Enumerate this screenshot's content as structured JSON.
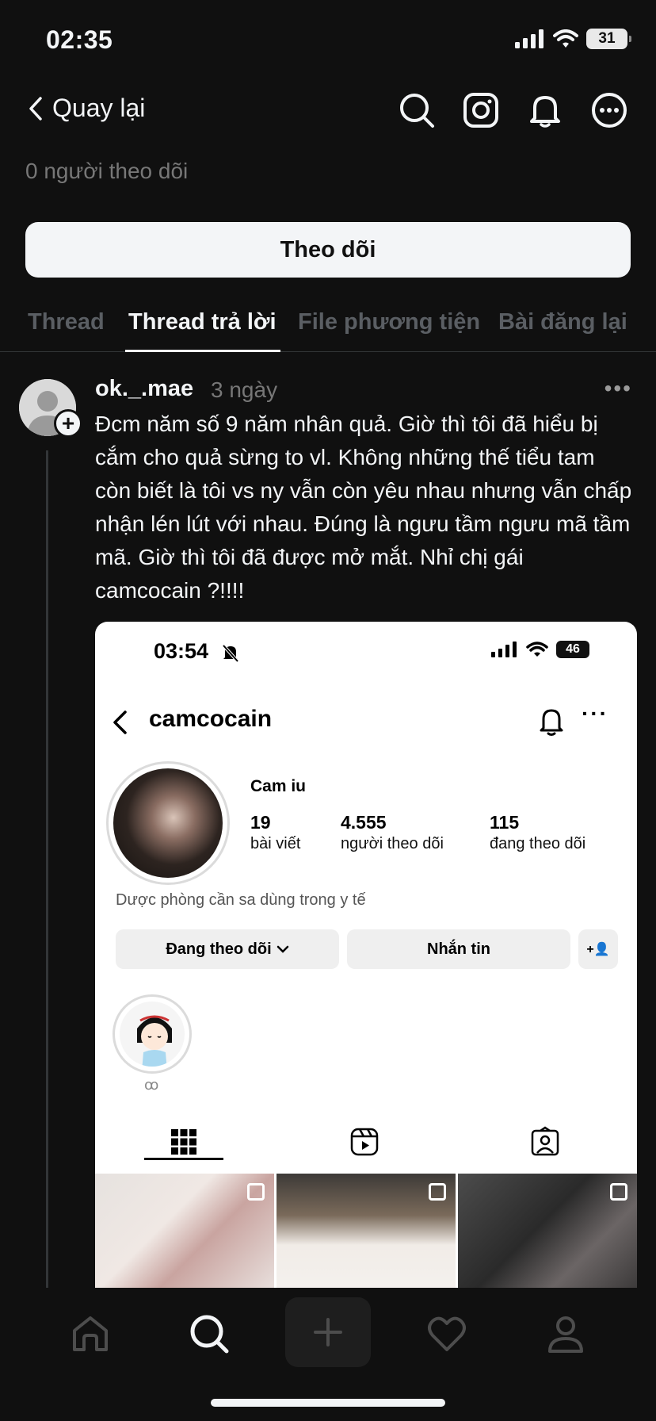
{
  "status_bar": {
    "time": "02:35",
    "battery": "31"
  },
  "nav": {
    "back_label": "Quay lại"
  },
  "profile": {
    "followers_text": "0 người theo dõi",
    "follow_button": "Theo dõi"
  },
  "tabs": [
    {
      "label": "Thread"
    },
    {
      "label": "Thread trả lời"
    },
    {
      "label": "File phương tiện"
    },
    {
      "label": "Bài đăng lại"
    }
  ],
  "post": {
    "username": "ok._.mae",
    "time": "3 ngày",
    "more": "•••",
    "text": "Đcm năm số 9 năm nhân quả. Giờ thì tôi đã hiểu bị cắm cho quả sừng to vl. Không những thế tiểu tam còn biết là tôi vs ny vẫn còn yêu nhau nhưng vẫn chấp nhận lén lút với nhau. Đúng là ngưu tầm ngưu mã tầm mã. Giờ thì tôi đã được mở mắt. Nhỉ chị gái camcocain ?!!!!"
  },
  "embed": {
    "time": "03:54",
    "battery": "46",
    "username": "camcocain",
    "more": "···",
    "display_name": "Cam iu",
    "stats": [
      {
        "value": "19",
        "label": "bài viết"
      },
      {
        "value": "4.555",
        "label": "người theo dõi"
      },
      {
        "value": "115",
        "label": "đang theo dõi"
      }
    ],
    "bio": "Dược phòng cần sa dùng trong y tế",
    "following_button": "Đang theo dõi",
    "message_button": "Nhắn tin",
    "add_icon": "+👤",
    "highlight_label": "ꝏ"
  },
  "colors": {
    "background": "#101010",
    "text": "#f3f5f7",
    "muted": "#777777"
  }
}
